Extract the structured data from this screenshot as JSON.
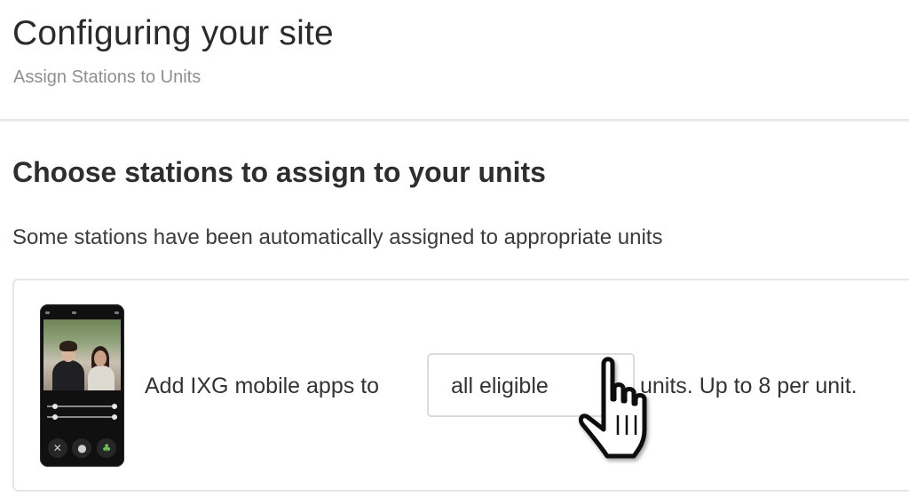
{
  "header": {
    "title": "Configuring your site",
    "subtitle": "Assign Stations to Units"
  },
  "section": {
    "heading": "Choose stations to assign to your units",
    "description": "Some stations have been automatically assigned to appropriate units"
  },
  "mobile_apps_row": {
    "text_before": "Add IXG mobile apps to",
    "select_value": "all eligible",
    "text_after": "units. Up to 8 per unit."
  },
  "icons": {
    "phone_image": "ixg-mobile-app-phone-image",
    "caret": "chevron-down-icon",
    "cursor": "hand-pointer-cursor-icon"
  },
  "colors": {
    "text": "#2a2a2a",
    "muted": "#8f8f8f",
    "border": "#e6e6e6"
  }
}
